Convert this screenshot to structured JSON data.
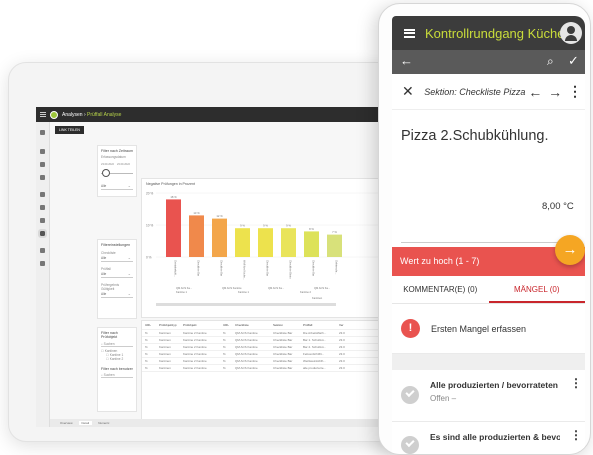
{
  "desktop": {
    "breadcrumb_root": "Analysen",
    "breadcrumb_sep": " › ",
    "breadcrumb_current": "Prüffall Analyse",
    "link_button": "LINK TEILEN",
    "filter_time": {
      "title": "Filter nach Zeitraum",
      "label": "Erfassungsdatum",
      "date_from": "23.09.2022",
      "date_to": "23.09.2022",
      "select": "Alle"
    },
    "filter_settings": {
      "title": "Filtereinstellungen",
      "checklist_label": "Checkliste",
      "checklist_value": "Alle",
      "pruefall_label": "Prüffall",
      "pruefall_value": "Alle",
      "validity_label": "Prüfergebnis Gültigkeit",
      "validity_value": "Alle"
    },
    "filter_object": {
      "title": "Filter nach Prüfobjekt",
      "search": "Suchen",
      "tree_root": "Kantinen",
      "tree_child1": "Kantine 1",
      "tree_child2": "Kantine 2"
    },
    "filter_user": {
      "title": "Filter nach benutzerdef. F...",
      "search": "Suchen"
    },
    "tabs": [
      "Overview",
      "Detail",
      "Numeric"
    ],
    "table": {
      "headers": [
        "URL",
        "Prüfobjekttyp",
        "Prüfobjekt",
        "URL",
        "Checkliste",
        "Sektion",
        "Prüffall",
        "Ver"
      ],
      "rows": [
        [
          "%",
          "Kantinen",
          "Kantine 2 Kantine",
          "%",
          "QM ACS Kantine",
          "Checkliste Bar",
          "Die Arbeitsfläch...",
          "23.0"
        ],
        [
          "%",
          "Kantinen",
          "Kantine 2 Kantine",
          "%",
          "QM ACS Kantine",
          "Checkliste Bar",
          "Bar 1. Schubkü...",
          "23.0"
        ],
        [
          "%",
          "Kantinen",
          "Kantine 2 Kantine",
          "%",
          "QM ACS Kantine",
          "Checkliste Bar",
          "Bar 2. Schubkü...",
          "23.0"
        ],
        [
          "%",
          "Kantinen",
          "Kantine 2 Kantine",
          "%",
          "QM ACS Kantine",
          "Checkliste Bar",
          "Fettverdichtfilt...",
          "23.0"
        ],
        [
          "%",
          "Kantinen",
          "Kantine 2 Kantine",
          "%",
          "QM ACS Kantine",
          "Checkliste Bar",
          "Weißweinkühlh...",
          "23.0"
        ],
        [
          "%",
          "Kantinen",
          "Kantine 2 Kantine",
          "%",
          "QM ACS Kantine",
          "Checkliste Bar",
          "alle produzierte...",
          "23.0"
        ]
      ]
    }
  },
  "chart_data": {
    "type": "bar",
    "title": "Negative Prüfungen in Prozent",
    "y_ticks": [
      "20 %",
      "10 %",
      "0 %"
    ],
    "ylim": [
      0,
      20
    ],
    "categories": [
      "Getränkekühl...",
      "Checkliste Bar",
      "Checkliste Bar",
      "Wolf fürs Küche...",
      "Checkliste Bar",
      "Checkliste Bistro",
      "Checkliste Bar",
      "Gefrierschr..."
    ],
    "values": [
      18,
      13,
      12,
      9,
      9,
      9,
      8,
      7
    ],
    "value_labels": [
      "18 %",
      "13 %",
      "12 %",
      "9 %",
      "9 %",
      "9 %",
      "8 %",
      "7 %"
    ],
    "groups": [
      "QM ACS Ka...",
      "QM ACS Kantine",
      "QM ACS Ka...",
      "QM ACS Ka..."
    ],
    "group_sub": [
      "Kantine 1",
      "Kantine 1",
      "Kantine 2"
    ],
    "bottom_label": "Kantinen",
    "colors": [
      "#e9534f",
      "#f0894b",
      "#f3a64a",
      "#ede24d",
      "#ede24d",
      "#e9e45a",
      "#dde259",
      "#d8e17a"
    ]
  },
  "phone": {
    "title": "Kontrollrundgang Küche",
    "section": "Sektion: Checkliste Pizza",
    "heading": "Pizza 2.Schubkühlung.",
    "value": "8,00 °C",
    "warning": "Wert zu hoch (1 - 7)",
    "tab_comments": "KOMMENTAR(E) (0)",
    "tab_defects": "MÄNGEL (0)",
    "add_defect": "Ersten Mangel erfassen",
    "items": [
      {
        "title": "Alle produzierten / bevorrateten L...",
        "status": "Offen –"
      },
      {
        "title": "Es sind alle produzierten & bevorra...",
        "status": ""
      }
    ],
    "accent": "#c9dc3a",
    "fab_color": "#f5a623",
    "warn_color": "#e9534f"
  }
}
